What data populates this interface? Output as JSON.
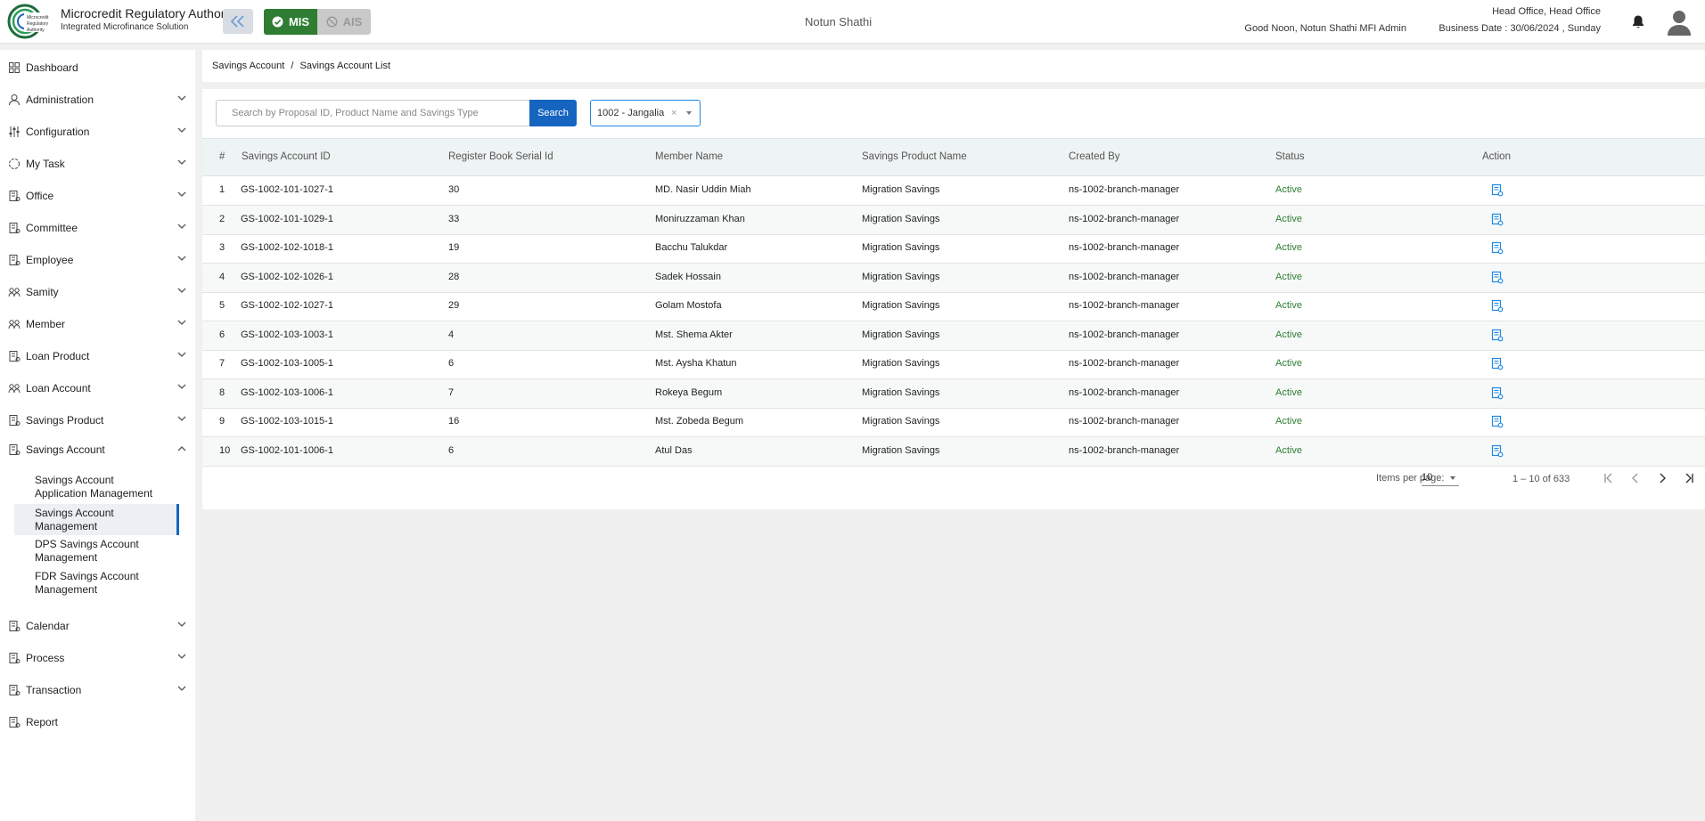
{
  "header": {
    "org_title": "Microcredit Regulatory Authority",
    "org_subtitle": "Integrated Microfinance Solution",
    "logo_text": [
      "Microcredit",
      "Regulatory",
      "Authority"
    ],
    "mis_label": "MIS",
    "ais_label": "AIS",
    "org_name": "Notun Shathi",
    "greeting": "Good Noon, Notun Shathi MFI Admin",
    "office": "Head Office, Head Office",
    "business_date": "Business Date : 30/06/2024 , Sunday"
  },
  "sidebar": {
    "items": [
      {
        "label": "Dashboard",
        "icon": "dashboard-icon"
      },
      {
        "label": "Administration",
        "icon": "admin-icon"
      },
      {
        "label": "Configuration",
        "icon": "config-icon"
      },
      {
        "label": "My Task",
        "icon": "task-icon"
      },
      {
        "label": "Office",
        "icon": "office-icon"
      },
      {
        "label": "Committee",
        "icon": "committee-icon"
      },
      {
        "label": "Employee",
        "icon": "employee-icon"
      },
      {
        "label": "Samity",
        "icon": "samity-icon"
      },
      {
        "label": "Member",
        "icon": "member-icon"
      },
      {
        "label": "Loan Product",
        "icon": "loan-product-icon"
      },
      {
        "label": "Loan Account",
        "icon": "loan-account-icon"
      },
      {
        "label": "Savings Product",
        "icon": "savings-product-icon"
      },
      {
        "label": "Savings Account",
        "icon": "savings-account-icon"
      },
      {
        "label": "Calendar",
        "icon": "calendar-icon"
      },
      {
        "label": "Process",
        "icon": "process-icon"
      },
      {
        "label": "Transaction",
        "icon": "transaction-icon"
      },
      {
        "label": "Report",
        "icon": "report-icon"
      }
    ],
    "sub_items": [
      {
        "line1": "Savings Account",
        "line2": "Application Management"
      },
      {
        "line1": "Savings Account",
        "line2": "Management"
      },
      {
        "line1": "DPS Savings Account",
        "line2": "Management"
      },
      {
        "line1": "FDR Savings Account",
        "line2": "Management"
      }
    ]
  },
  "breadcrumb": {
    "parent": "Savings Account",
    "separator": "/",
    "current": "Savings Account List"
  },
  "search": {
    "placeholder": "Search by Proposal ID, Product Name and Savings Type",
    "button_label": "Search",
    "branch_value": "1002 - Jangalia",
    "clear_glyph": "×"
  },
  "table": {
    "columns": [
      "#",
      "Savings Account ID",
      "Register Book Serial Id",
      "Member Name",
      "Savings Product Name",
      "Created By",
      "Status",
      "Action"
    ],
    "rows": [
      {
        "n": "1",
        "id": "GS-1002-101-1027-1",
        "serial": "30",
        "member": "MD. Nasir Uddin Miah",
        "product": "Migration Savings",
        "created_by": "ns-1002-branch-manager",
        "status": "Active"
      },
      {
        "n": "2",
        "id": "GS-1002-101-1029-1",
        "serial": "33",
        "member": "Moniruzzaman Khan",
        "product": "Migration Savings",
        "created_by": "ns-1002-branch-manager",
        "status": "Active"
      },
      {
        "n": "3",
        "id": "GS-1002-102-1018-1",
        "serial": "19",
        "member": "Bacchu Talukdar",
        "product": "Migration Savings",
        "created_by": "ns-1002-branch-manager",
        "status": "Active"
      },
      {
        "n": "4",
        "id": "GS-1002-102-1026-1",
        "serial": "28",
        "member": "Sadek Hossain",
        "product": "Migration Savings",
        "created_by": "ns-1002-branch-manager",
        "status": "Active"
      },
      {
        "n": "5",
        "id": "GS-1002-102-1027-1",
        "serial": "29",
        "member": "Golam Mostofa",
        "product": "Migration Savings",
        "created_by": "ns-1002-branch-manager",
        "status": "Active"
      },
      {
        "n": "6",
        "id": "GS-1002-103-1003-1",
        "serial": "4",
        "member": "Mst. Shema Akter",
        "product": "Migration Savings",
        "created_by": "ns-1002-branch-manager",
        "status": "Active"
      },
      {
        "n": "7",
        "id": "GS-1002-103-1005-1",
        "serial": "6",
        "member": "Mst. Aysha Khatun",
        "product": "Migration Savings",
        "created_by": "ns-1002-branch-manager",
        "status": "Active"
      },
      {
        "n": "8",
        "id": "GS-1002-103-1006-1",
        "serial": "7",
        "member": "Rokeya Begum",
        "product": "Migration Savings",
        "created_by": "ns-1002-branch-manager",
        "status": "Active"
      },
      {
        "n": "9",
        "id": "GS-1002-103-1015-1",
        "serial": "16",
        "member": "Mst. Zobeda Begum",
        "product": "Migration Savings",
        "created_by": "ns-1002-branch-manager",
        "status": "Active"
      },
      {
        "n": "10",
        "id": "GS-1002-101-1006-1",
        "serial": "6",
        "member": "Atul Das",
        "product": "Migration Savings",
        "created_by": "ns-1002-branch-manager",
        "status": "Active"
      }
    ]
  },
  "paginator": {
    "items_per_page_label": "Items per page:",
    "page_size": "10",
    "range": "1 – 10 of 633"
  },
  "colors": {
    "primary": "#1565c0",
    "mis_green": "#2e7d32",
    "status_active": "#2e7d32"
  }
}
